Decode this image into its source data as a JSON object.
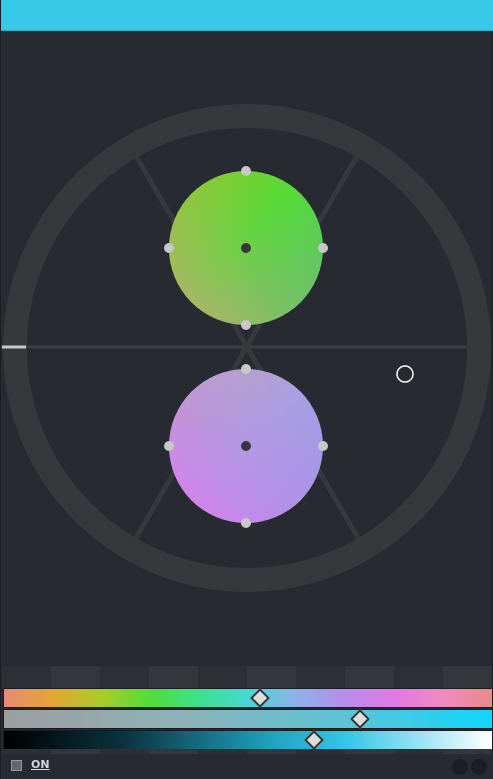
{
  "window": {
    "title_bar_color": "#38c9e9"
  },
  "harmony_wheel": {
    "ring_color": "#37383b",
    "center_line_color": "#3a3c40",
    "circles": [
      {
        "name": "primary",
        "gradient": [
          "#9ccc2a",
          "#4fdd35",
          "#5fbf7a",
          "#caa775"
        ]
      },
      {
        "name": "secondary",
        "gradient": [
          "#ba9fb6",
          "#a0a6dc",
          "#a38af0",
          "#e07ae8"
        ]
      }
    ]
  },
  "sliders": {
    "hue": {
      "name": "hue",
      "position": 0.525
    },
    "saturation": {
      "name": "saturation",
      "position": 0.73
    },
    "value": {
      "name": "value",
      "position": 0.635
    }
  },
  "footer": {
    "checkbox_label": "ON",
    "checkbox_checked": false
  }
}
